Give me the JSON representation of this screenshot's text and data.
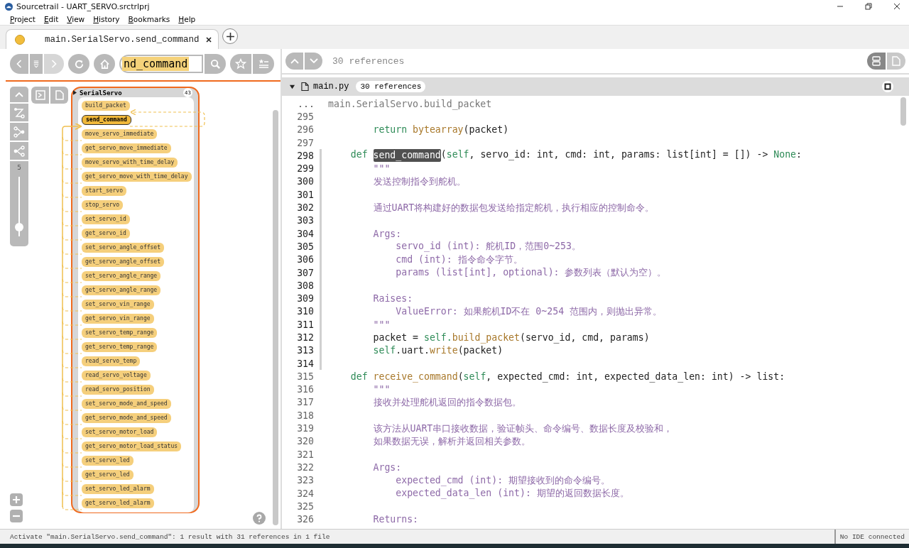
{
  "window": {
    "title": "Sourcetrail - UART_SERVO.srctrlprj"
  },
  "menu": [
    "Project",
    "Edit",
    "View",
    "History",
    "Bookmarks",
    "Help"
  ],
  "tabs": [
    {
      "label": "main.SerialServo.send_command",
      "selected": true
    }
  ],
  "toolbar": {
    "search": {
      "value": "nd_command"
    },
    "forward_disabled": true
  },
  "graph": {
    "class_name": "SerialServo",
    "count": "43",
    "depth_label": "5",
    "depth": {
      "level": 0.15
    },
    "nodes": [
      {
        "name": "build_packet",
        "selected": false,
        "kind": "callee"
      },
      {
        "name": "send_command",
        "selected": true,
        "kind": "focus"
      },
      {
        "name": "move_servo_immediate",
        "selected": false,
        "kind": "caller"
      },
      {
        "name": "get_servo_move_immediate",
        "selected": false,
        "kind": "caller"
      },
      {
        "name": "move_servo_with_time_delay",
        "selected": false,
        "kind": "caller"
      },
      {
        "name": "get_servo_move_with_time_delay",
        "selected": false,
        "kind": "caller"
      },
      {
        "name": "start_servo",
        "selected": false,
        "kind": "caller"
      },
      {
        "name": "stop_servo",
        "selected": false,
        "kind": "caller"
      },
      {
        "name": "set_servo_id",
        "selected": false,
        "kind": "caller"
      },
      {
        "name": "get_servo_id",
        "selected": false,
        "kind": "caller"
      },
      {
        "name": "set_servo_angle_offset",
        "selected": false,
        "kind": "caller"
      },
      {
        "name": "get_servo_angle_offset",
        "selected": false,
        "kind": "caller"
      },
      {
        "name": "set_servo_angle_range",
        "selected": false,
        "kind": "caller"
      },
      {
        "name": "get_servo_angle_range",
        "selected": false,
        "kind": "caller"
      },
      {
        "name": "set_servo_vin_range",
        "selected": false,
        "kind": "caller"
      },
      {
        "name": "get_servo_vin_range",
        "selected": false,
        "kind": "caller"
      },
      {
        "name": "set_servo_temp_range",
        "selected": false,
        "kind": "caller"
      },
      {
        "name": "get_servo_temp_range",
        "selected": false,
        "kind": "caller"
      },
      {
        "name": "read_servo_temp",
        "selected": false,
        "kind": "caller"
      },
      {
        "name": "read_servo_voltage",
        "selected": false,
        "kind": "caller"
      },
      {
        "name": "read_servo_position",
        "selected": false,
        "kind": "caller"
      },
      {
        "name": "set_servo_mode_and_speed",
        "selected": false,
        "kind": "caller"
      },
      {
        "name": "get_servo_mode_and_speed",
        "selected": false,
        "kind": "caller"
      },
      {
        "name": "set_servo_motor_load",
        "selected": false,
        "kind": "caller"
      },
      {
        "name": "get_servo_motor_load_status",
        "selected": false,
        "kind": "caller"
      },
      {
        "name": "set_servo_led",
        "selected": false,
        "kind": "caller"
      },
      {
        "name": "get_servo_led",
        "selected": false,
        "kind": "caller"
      },
      {
        "name": "set_servo_led_alarm",
        "selected": false,
        "kind": "caller"
      },
      {
        "name": "get_servo_led_alarm",
        "selected": false,
        "kind": "caller"
      }
    ]
  },
  "code": {
    "references": "30 references",
    "view_buttons": [
      {
        "selected": true
      },
      {
        "selected": false
      }
    ],
    "file": {
      "name": "main.py",
      "references": "30 references",
      "expanded": true
    },
    "context": {
      "marker": "...",
      "text": "main.SerialServo.build_packet"
    },
    "lines": [
      {
        "number": "295",
        "active": false
      },
      {
        "number": "296",
        "active": false,
        "tokens": [
          {
            "text": "        return ",
            "kind": "keyword"
          },
          {
            "text": "bytearray",
            "kind": "call"
          },
          {
            "text": "(packet)",
            "kind": "plain"
          }
        ]
      },
      {
        "number": "297",
        "active": false
      },
      {
        "number": "298",
        "active": true,
        "tokens": [
          {
            "text": "    def ",
            "kind": "keyword"
          },
          {
            "text": "send_command",
            "kind": "focus"
          },
          {
            "text": "(",
            "kind": "plain"
          },
          {
            "text": "self",
            "kind": "keyword"
          },
          {
            "text": ", servo_id: int, cmd: int, params: list[int] = []) -> ",
            "kind": "plain"
          },
          {
            "text": "None",
            "kind": "keyword"
          },
          {
            "text": ":",
            "kind": "plain"
          }
        ]
      },
      {
        "number": "299",
        "active": true,
        "tokens": [
          {
            "text": "        \"\"\"",
            "kind": "doc"
          }
        ]
      },
      {
        "number": "300",
        "active": true,
        "tokens": [
          {
            "text": "        发送控制指令到舵机。",
            "kind": "doc"
          }
        ]
      },
      {
        "number": "301",
        "active": true
      },
      {
        "number": "302",
        "active": true,
        "tokens": [
          {
            "text": "        通过UART将构建好的数据包发送给指定舵机，执行相应的控制命令。",
            "kind": "doc"
          }
        ]
      },
      {
        "number": "303",
        "active": true
      },
      {
        "number": "304",
        "active": true,
        "tokens": [
          {
            "text": "        Args:",
            "kind": "doc"
          }
        ]
      },
      {
        "number": "305",
        "active": true,
        "tokens": [
          {
            "text": "            servo_id (int): 舵机ID，范围0~253。",
            "kind": "doc"
          }
        ]
      },
      {
        "number": "306",
        "active": true,
        "tokens": [
          {
            "text": "            cmd (int): 指令命令字节。",
            "kind": "doc"
          }
        ]
      },
      {
        "number": "307",
        "active": true,
        "tokens": [
          {
            "text": "            params (list[int], optional): 参数列表（默认为空）。",
            "kind": "doc"
          }
        ]
      },
      {
        "number": "308",
        "active": true
      },
      {
        "number": "309",
        "active": true,
        "tokens": [
          {
            "text": "        Raises:",
            "kind": "doc"
          }
        ]
      },
      {
        "number": "310",
        "active": true,
        "tokens": [
          {
            "text": "            ValueError: 如果舵机ID不在 0~254 范围内，则抛出异常。",
            "kind": "doc"
          }
        ]
      },
      {
        "number": "311",
        "active": true,
        "tokens": [
          {
            "text": "        \"\"\"",
            "kind": "doc"
          }
        ]
      },
      {
        "number": "312",
        "active": true,
        "tokens": [
          {
            "text": "        packet = ",
            "kind": "plain"
          },
          {
            "text": "self.",
            "kind": "keyword"
          },
          {
            "text": "build_packet",
            "kind": "call"
          },
          {
            "text": "(servo_id, cmd, params)",
            "kind": "plain"
          }
        ]
      },
      {
        "number": "313",
        "active": true,
        "tokens": [
          {
            "text": "        self",
            "kind": "keyword"
          },
          {
            "text": ".uart.",
            "kind": "plain"
          },
          {
            "text": "write",
            "kind": "call"
          },
          {
            "text": "(packet)",
            "kind": "plain"
          }
        ]
      },
      {
        "number": "314",
        "active": true
      },
      {
        "number": "315",
        "active": false,
        "tokens": [
          {
            "text": "    def ",
            "kind": "keyword"
          },
          {
            "text": "receive_command",
            "kind": "call"
          },
          {
            "text": "(",
            "kind": "plain"
          },
          {
            "text": "self",
            "kind": "keyword"
          },
          {
            "text": ", expected_cmd: int, expected_data_len: int) -> list:",
            "kind": "plain"
          }
        ]
      },
      {
        "number": "316",
        "active": false,
        "tokens": [
          {
            "text": "        \"\"\"",
            "kind": "doc"
          }
        ]
      },
      {
        "number": "317",
        "active": false,
        "tokens": [
          {
            "text": "        接收并处理舵机返回的指令数据包。",
            "kind": "doc"
          }
        ]
      },
      {
        "number": "318",
        "active": false
      },
      {
        "number": "319",
        "active": false,
        "tokens": [
          {
            "text": "        该方法从UART串口接收数据，验证帧头、命令编号、数据长度及校验和，",
            "kind": "doc"
          }
        ]
      },
      {
        "number": "320",
        "active": false,
        "tokens": [
          {
            "text": "        如果数据无误，解析并返回相关参数。",
            "kind": "doc"
          }
        ]
      },
      {
        "number": "321",
        "active": false
      },
      {
        "number": "322",
        "active": false,
        "tokens": [
          {
            "text": "        Args:",
            "kind": "doc"
          }
        ]
      },
      {
        "number": "323",
        "active": false,
        "tokens": [
          {
            "text": "            expected_cmd (int): 期望接收到的命令编号。",
            "kind": "doc"
          }
        ]
      },
      {
        "number": "324",
        "active": false,
        "tokens": [
          {
            "text": "            expected_data_len (int): 期望的返回数据长度。",
            "kind": "doc"
          }
        ]
      },
      {
        "number": "325",
        "active": false
      },
      {
        "number": "326",
        "active": false,
        "tokens": [
          {
            "text": "        Returns:",
            "kind": "doc"
          }
        ]
      }
    ]
  },
  "status_bar": {
    "message": "Activate \"main.SerialServo.send_command\": 1 result with 31 references in 1 file",
    "ide": "No IDE connected"
  }
}
